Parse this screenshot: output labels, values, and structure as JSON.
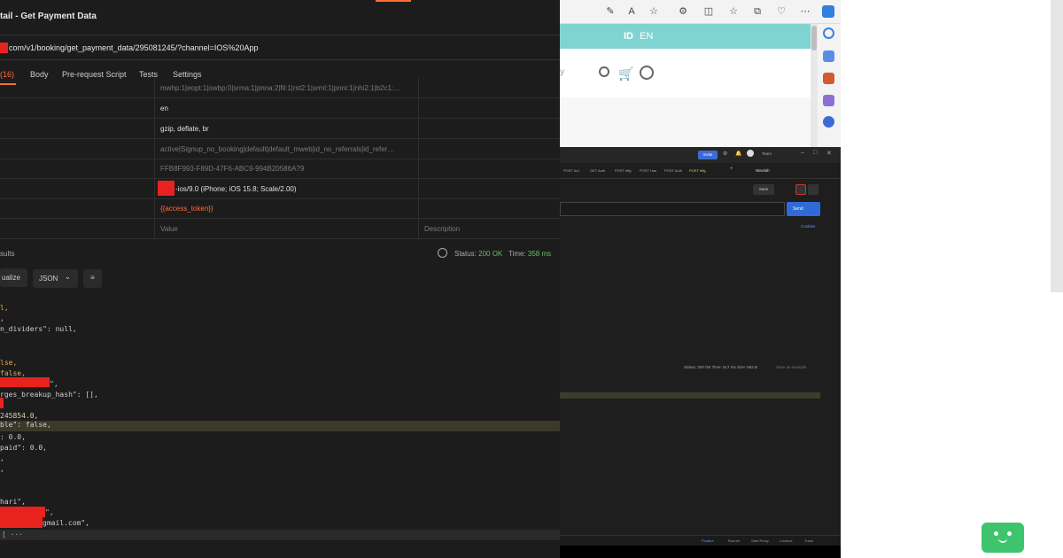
{
  "left": {
    "title": "tail - Get Payment Data",
    "url": "com/v1/booking/get_payment_data/295081245/?channel=IOS%20App",
    "tabs": [
      "(16)",
      "Body",
      "Pre-request Script",
      "Tests",
      "Settings"
    ],
    "header_values": [
      "mwhp:1|eopt:1|owbp:0|srma:1|pnna:2|fil:1|rst2:1|srml:1|pnni:1|nhi2:1|b2c1:…",
      "en",
      "gzip, deflate, br",
      "active|Signup_no_booking|default|default_mweb|id_no_referrals|id_refer…",
      "FFB8F993-F89D-47F6-ABC9-994B20586A79",
      "-ios/9.0 (iPhone; iOS 15.8; Scale/2.00)",
      "{{access_token}}"
    ],
    "value_placeholder": "Value",
    "description_placeholder": "Description",
    "results_label": "sults",
    "status_label": "Status:",
    "status_value": "200 OK",
    "time_label": "Time:",
    "time_value": "358 ms",
    "visualize_label": "ualize",
    "json_label": "JSON",
    "code": [
      "l,",
      ",",
      "n_dividers\": null,",
      "",
      "",
      "lse,",
      "false,",
      "\",",
      "rges_breakup_hash\": [],",
      "",
      "  245854.0,",
      "ble\": false,",
      ": 0.0,",
      "paid\": 0.0,",
      ",",
      ",",
      "",
      "",
      "hari\",",
      "\",",
      "gmail.com\","
    ],
    "collapsed": "[ ··· "
  },
  "browser": {
    "lang_id": "ID",
    "lang_en": "EN",
    "search_icon": "search-icon",
    "cart_icon": "cart-icon",
    "user_icon": "user-icon"
  },
  "pm_small": {
    "invite": "Invite",
    "team": "Team",
    "tabs": [
      "POST Aul",
      "GET Auth",
      "POST bffg",
      "POST Hau",
      "POST Auth",
      "POST bffg"
    ],
    "env": "Wardah",
    "save": "Save",
    "send": "Send",
    "cookies": "Cookies",
    "status": "Status: 200 OK   Time: 517 ms   Size: 652 B",
    "save_example": "Save as example",
    "footer": [
      "Postbot",
      "Runner",
      "Start Proxy",
      "Cookies",
      "Trash"
    ]
  }
}
